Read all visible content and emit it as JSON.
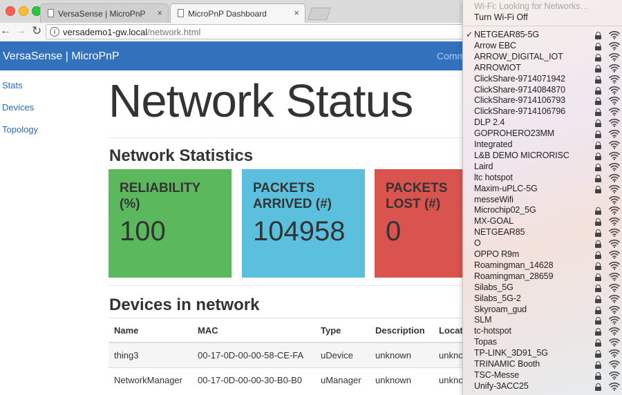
{
  "browser": {
    "tabs": [
      {
        "title": "VersaSense | MicroPnP",
        "active": false
      },
      {
        "title": "MicroPnP Dashboard",
        "active": true
      }
    ],
    "close_glyph": "×",
    "url_host": "versademo1-gw.local",
    "url_path": "/network.html"
  },
  "navbar": {
    "brand": "VersaSense | MicroPnP",
    "link": "Comm"
  },
  "sidebar": {
    "items": [
      {
        "label": "Stats"
      },
      {
        "label": "Devices"
      },
      {
        "label": "Topology"
      }
    ]
  },
  "main": {
    "title": "Network Status",
    "stats_heading": "Network Statistics",
    "cards": [
      {
        "label_line1": "RELIABILITY",
        "label_line2": "(%)",
        "value": "100",
        "color": "#5cb85c"
      },
      {
        "label_line1": "PACKETS",
        "label_line2": "ARRIVED (#)",
        "value": "104958",
        "color": "#5bc0de"
      },
      {
        "label_line1": "PACKETS",
        "label_line2": "LOST (#)",
        "value": "0",
        "color": "#d9534f"
      }
    ],
    "devices_heading": "Devices in network",
    "table": {
      "headers": [
        "Name",
        "MAC",
        "Type",
        "Description",
        "Locat"
      ],
      "rows": [
        [
          "thing3",
          "00-17-0D-00-00-58-CE-FA",
          "uDevice",
          "unknown",
          "unknc"
        ],
        [
          "NetworkManager",
          "00-17-0D-00-00-30-B0-B0",
          "uManager",
          "unknown",
          "unknc"
        ]
      ]
    }
  },
  "wifi_menu": {
    "status": "Wi-Fi: Looking for Networks…",
    "toggle": "Turn Wi-Fi Off",
    "checkmark": "✓",
    "networks": [
      {
        "ssid": "NETGEAR85-5G",
        "connected": true,
        "locked": true
      },
      {
        "ssid": "Arrow EBC",
        "connected": false,
        "locked": true
      },
      {
        "ssid": "ARROW_DIGITAL_IOT",
        "connected": false,
        "locked": true
      },
      {
        "ssid": "ARROWIOT",
        "connected": false,
        "locked": true
      },
      {
        "ssid": "ClickShare-9714071942",
        "connected": false,
        "locked": true
      },
      {
        "ssid": "ClickShare-9714084870",
        "connected": false,
        "locked": true
      },
      {
        "ssid": "ClickShare-9714106793",
        "connected": false,
        "locked": true
      },
      {
        "ssid": "ClickShare-9714106796",
        "connected": false,
        "locked": true
      },
      {
        "ssid": "DLP 2.4",
        "connected": false,
        "locked": true
      },
      {
        "ssid": "GOPROHERO23MM",
        "connected": false,
        "locked": true
      },
      {
        "ssid": "Integrated",
        "connected": false,
        "locked": true
      },
      {
        "ssid": "L&B DEMO MICRORISC",
        "connected": false,
        "locked": true
      },
      {
        "ssid": "Laird",
        "connected": false,
        "locked": true
      },
      {
        "ssid": "ltc hotspot",
        "connected": false,
        "locked": true
      },
      {
        "ssid": "Maxim-uPLC-5G",
        "connected": false,
        "locked": true
      },
      {
        "ssid": "messeWifi",
        "connected": false,
        "locked": false
      },
      {
        "ssid": "Microchip02_5G",
        "connected": false,
        "locked": true
      },
      {
        "ssid": "MX-GOAL",
        "connected": false,
        "locked": true
      },
      {
        "ssid": "NETGEAR85",
        "connected": false,
        "locked": true
      },
      {
        "ssid": "O",
        "connected": false,
        "locked": true
      },
      {
        "ssid": "OPPO R9m",
        "connected": false,
        "locked": true
      },
      {
        "ssid": "Roamingman_14628",
        "connected": false,
        "locked": true
      },
      {
        "ssid": "Roamingman_28659",
        "connected": false,
        "locked": true
      },
      {
        "ssid": "Silabs_5G",
        "connected": false,
        "locked": true
      },
      {
        "ssid": "Silabs_5G-2",
        "connected": false,
        "locked": true
      },
      {
        "ssid": "Skyroam_gud",
        "connected": false,
        "locked": true
      },
      {
        "ssid": "SLM",
        "connected": false,
        "locked": true
      },
      {
        "ssid": "tc-hotspot",
        "connected": false,
        "locked": true
      },
      {
        "ssid": "Topas",
        "connected": false,
        "locked": true
      },
      {
        "ssid": "TP-LINK_3D91_5G",
        "connected": false,
        "locked": true
      },
      {
        "ssid": "TRINAMIC Booth",
        "connected": false,
        "locked": true
      },
      {
        "ssid": "TSC-Messe",
        "connected": false,
        "locked": true
      },
      {
        "ssid": "Unify-3ACC25",
        "connected": false,
        "locked": true
      }
    ]
  }
}
